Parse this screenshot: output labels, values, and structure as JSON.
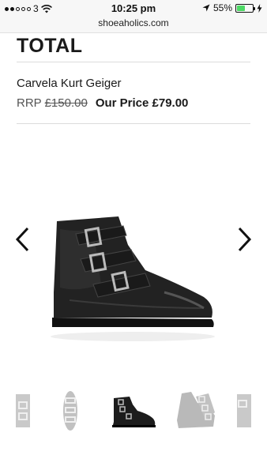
{
  "status_bar": {
    "carrier": "3",
    "time": "10:25 pm",
    "battery_percent_label": "55%",
    "battery_level": 0.55,
    "signal_bars_filled": 2,
    "signal_bars_total": 5
  },
  "browser": {
    "url": "shoeaholics.com"
  },
  "product": {
    "brand": "TOTAL",
    "name": "Carvela Kurt Geiger",
    "rrp_label": "RRP",
    "rrp_value": "£150.00",
    "our_price_label": "Our Price",
    "our_price_value": "£79.00"
  },
  "gallery": {
    "prev_icon": "chevron-left-icon",
    "next_icon": "chevron-right-icon",
    "active_thumbnail_index": 2,
    "thumbnail_count": 5
  },
  "colors": {
    "battery": "#4cd964",
    "text": "#1a1a1a",
    "divider": "#dcdcdc"
  }
}
